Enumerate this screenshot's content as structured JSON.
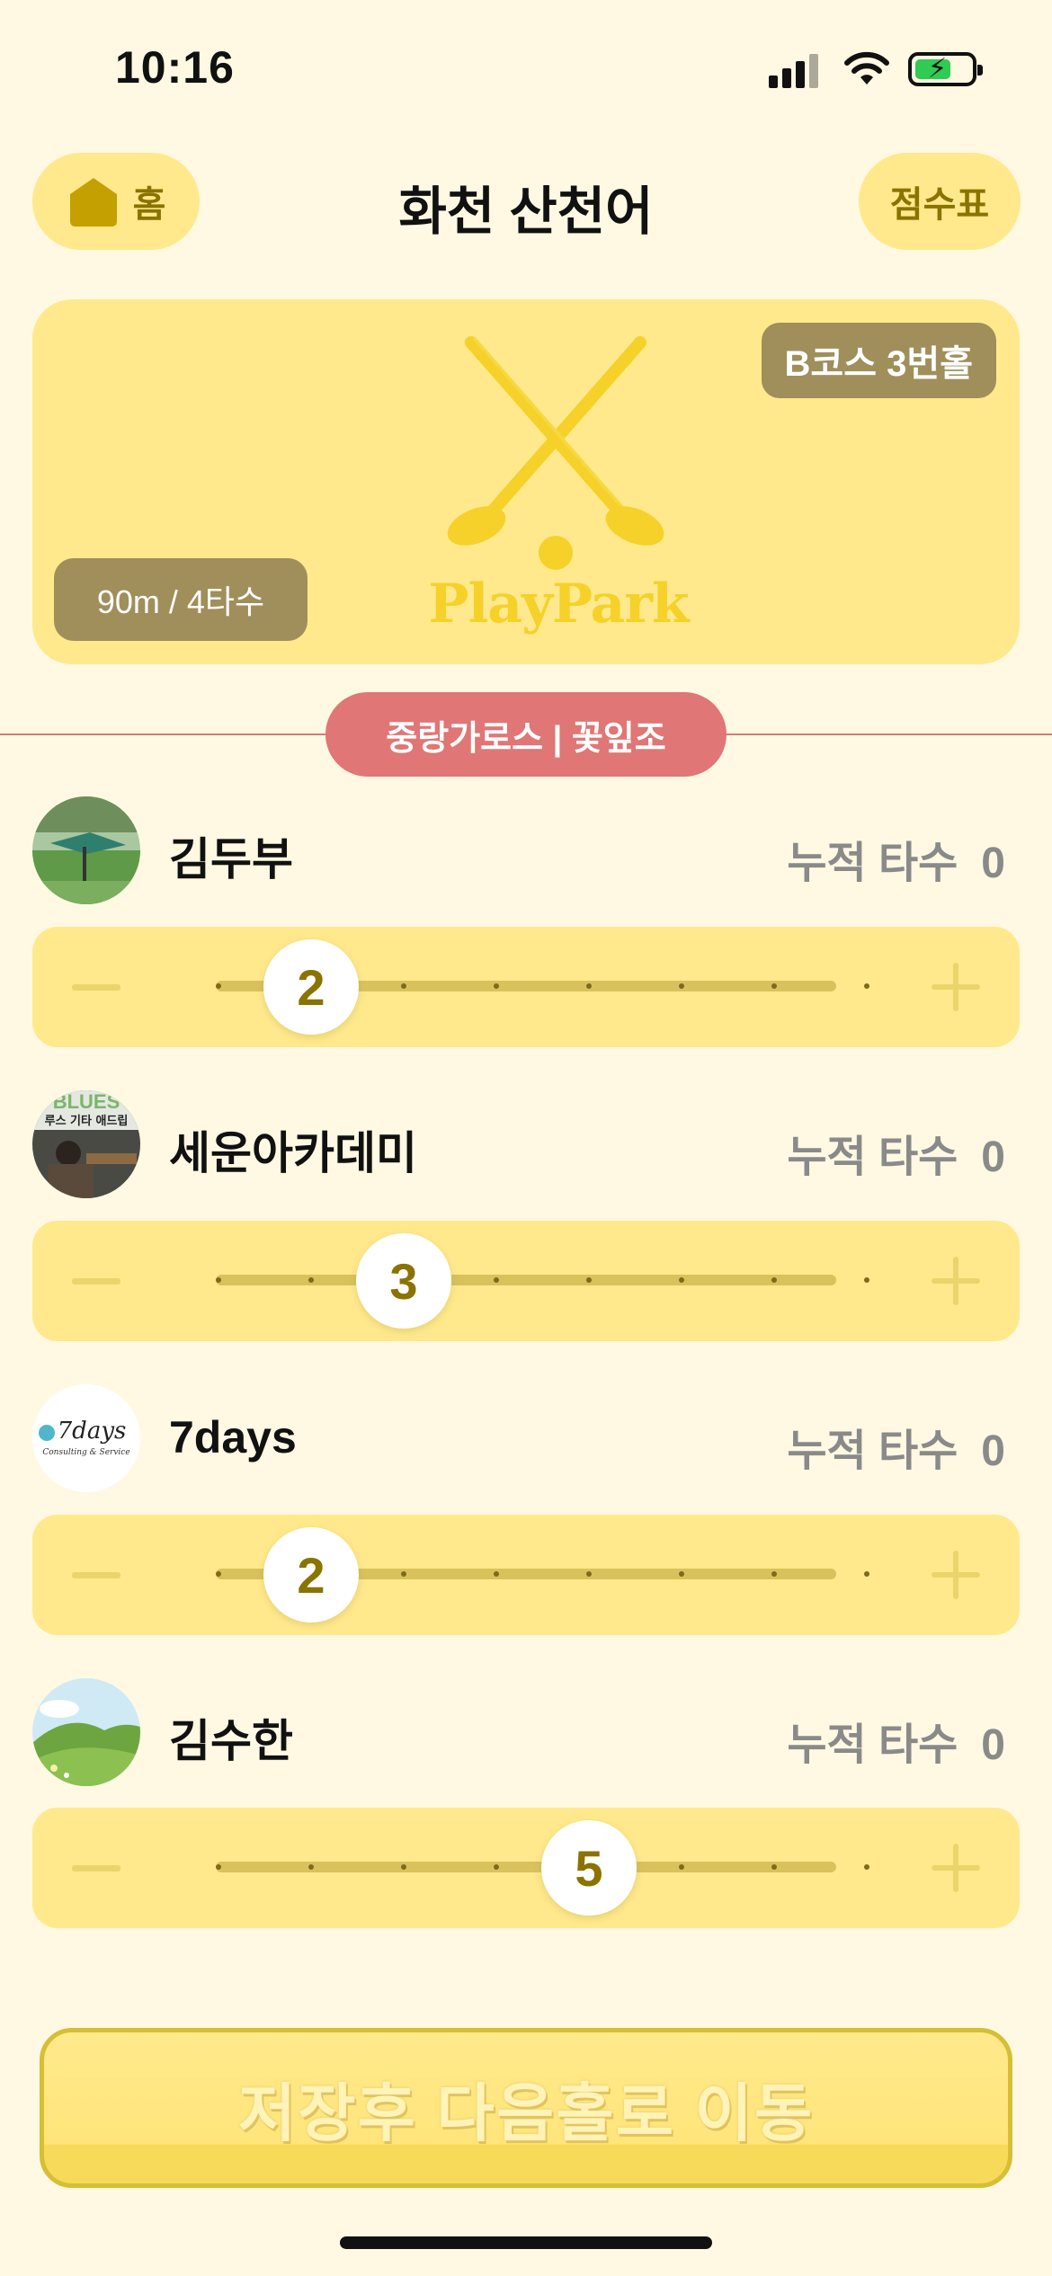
{
  "status_bar": {
    "time": "10:16",
    "battery_color": "#2FCB52"
  },
  "header": {
    "home_label": "홈",
    "title": "화천 산천어",
    "scorecard_label": "점수표"
  },
  "hero": {
    "hole": "B코스 3번홀",
    "distance_par": "90m / 4타수",
    "brand": "PlayPark",
    "brand_color": "#F5D12A"
  },
  "group": {
    "label": "중랑가로스 | 꽃잎조",
    "accent": "#E07675"
  },
  "cumulative_label": "누적 타수",
  "stepper_range": {
    "min": 1,
    "max": 8
  },
  "players": [
    {
      "name": "김두부",
      "cumulative": "0",
      "strokes": "2",
      "avatar": "golf-field-photo"
    },
    {
      "name": "세운아카데미",
      "cumulative": "0",
      "strokes": "3",
      "avatar": "blues-guitar-photo",
      "avatar_text": "루스 기타 애드립"
    },
    {
      "name": "7days",
      "cumulative": "0",
      "strokes": "2",
      "avatar": "7days-logo",
      "avatar_text": "7days",
      "avatar_subtext": "Consulting & Service"
    },
    {
      "name": "김수한",
      "cumulative": "0",
      "strokes": "5",
      "avatar": "green-hills-illustration"
    }
  ],
  "footer": {
    "save_label": "저장후 다음홀로 이동"
  }
}
